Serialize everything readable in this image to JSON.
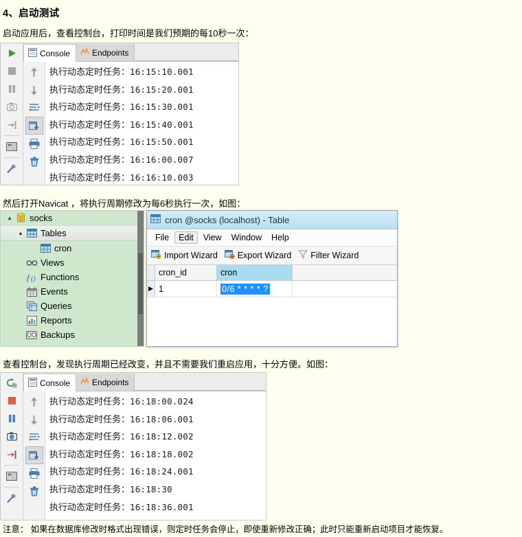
{
  "heading": "4、启动测试",
  "paragraphs": {
    "p1": "启动应用后，查看控制台，打印时间是我们预期的每10秒一次：",
    "p2": "然后打开Navicat ，将执行周期修改为每6秒执行一次，如图：",
    "p3": "查看控制台，发现执行周期已经改变，并且不需要我们重启应用，十分方便。如图："
  },
  "note": "注意： 如果在数据库修改时格式出现错误，则定时任务会停止，即使重新修改正确；此时只能重新启动项目才能恢复。",
  "console1": {
    "tabs": [
      {
        "label": "Console",
        "active": true,
        "icon": "console-icon"
      },
      {
        "label": "Endpoints",
        "active": false,
        "icon": "endpoints-icon"
      }
    ],
    "run_toolbar": [
      "run-icon",
      "stop-icon",
      "pause-icon",
      "camera-icon",
      "thread-dump-icon",
      "layout-icon",
      "attach-profiler-icon"
    ],
    "side_toolbar": [
      "scroll-up-icon",
      "scroll-down-icon",
      "soft-wrap-icon",
      "scroll-to-end-icon",
      "print-icon",
      "trash-icon"
    ],
    "lines": [
      {
        "text": "执行动态定时任务：",
        "time": "16:15:10.001"
      },
      {
        "text": "执行动态定时任务：",
        "time": "16:15:20.001"
      },
      {
        "text": "执行动态定时任务：",
        "time": "16:15:30.001"
      },
      {
        "text": "执行动态定时任务：",
        "time": "16:15:40.001"
      },
      {
        "text": "执行动态定时任务：",
        "time": "16:15:50.001"
      },
      {
        "text": "执行动态定时任务：",
        "time": "16:16:00.007"
      },
      {
        "text": "执行动态定时任务：",
        "time": "16:16:10.003"
      }
    ]
  },
  "console2": {
    "tabs": [
      {
        "label": "Console",
        "active": true,
        "icon": "console-icon"
      },
      {
        "label": "Endpoints",
        "active": false,
        "icon": "endpoints-icon"
      }
    ],
    "run_toolbar": [
      "rerun-icon",
      "stop-icon",
      "pause-icon",
      "camera-icon",
      "thread-dump-icon",
      "layout-icon",
      "attach-profiler-icon"
    ],
    "side_toolbar": [
      "scroll-up-icon",
      "scroll-down-icon",
      "soft-wrap-icon",
      "scroll-to-end-icon",
      "print-icon",
      "trash-icon"
    ],
    "lines": [
      {
        "text": "执行动态定时任务：",
        "time": "16:18:00.024"
      },
      {
        "text": "执行动态定时任务：",
        "time": "16:18:06.001"
      },
      {
        "text": "执行动态定时任务：",
        "time": "16:18:12.002"
      },
      {
        "text": "执行动态定时任务：",
        "time": "16:18:18.002"
      },
      {
        "text": "执行动态定时任务：",
        "time": "16:18:24.001"
      },
      {
        "text": "执行动态定时任务：",
        "time": "16:18:30"
      },
      {
        "text": "执行动态定时任务：",
        "time": "16:18:36.001"
      }
    ]
  },
  "tree": {
    "items": [
      {
        "label": "socks",
        "indent": 0,
        "icon": "database-icon",
        "twisty": "▲",
        "selected": false
      },
      {
        "label": "Tables",
        "indent": 1,
        "icon": "table-folder-icon",
        "twisty": "▲",
        "selected": true
      },
      {
        "label": "cron",
        "indent": 3,
        "icon": "table-icon",
        "twisty": "",
        "selected": false
      },
      {
        "label": "Views",
        "indent": 2,
        "icon": "views-icon",
        "twisty": "",
        "selected": false
      },
      {
        "label": "Functions",
        "indent": 2,
        "icon": "functions-icon",
        "twisty": "",
        "selected": false
      },
      {
        "label": "Events",
        "indent": 2,
        "icon": "events-icon",
        "twisty": "",
        "selected": false
      },
      {
        "label": "Queries",
        "indent": 2,
        "icon": "queries-icon",
        "twisty": "",
        "selected": false
      },
      {
        "label": "Reports",
        "indent": 2,
        "icon": "reports-icon",
        "twisty": "",
        "selected": false
      },
      {
        "label": "Backups",
        "indent": 2,
        "icon": "backups-icon",
        "twisty": "",
        "selected": false
      }
    ]
  },
  "navicat": {
    "title": "cron @socks (localhost) - Table",
    "menu": [
      {
        "label": "File",
        "pressed": false
      },
      {
        "label": "Edit",
        "pressed": true
      },
      {
        "label": "View",
        "pressed": false
      },
      {
        "label": "Window",
        "pressed": false
      },
      {
        "label": "Help",
        "pressed": false
      }
    ],
    "toolbar": [
      {
        "label": "Import Wizard",
        "icon": "import-wizard-icon"
      },
      {
        "label": "Export Wizard",
        "icon": "export-wizard-icon"
      },
      {
        "label": "Filter Wizard",
        "icon": "filter-wizard-icon"
      }
    ],
    "grid": {
      "columns": [
        "cron_id",
        "cron"
      ],
      "highlighted_column": "cron",
      "rows": [
        {
          "marker": "▶",
          "cron_id": "1",
          "cron": "0/6 * * * * ?",
          "selected_cell": "cron"
        }
      ]
    }
  },
  "colors": {
    "page_bg": "#fffff0",
    "tree_bg": "#cfe8cd",
    "selection_blue": "#1e90ff",
    "header_highlight": "#a9dcf0",
    "title_gradient_top": "#d6edf7"
  }
}
